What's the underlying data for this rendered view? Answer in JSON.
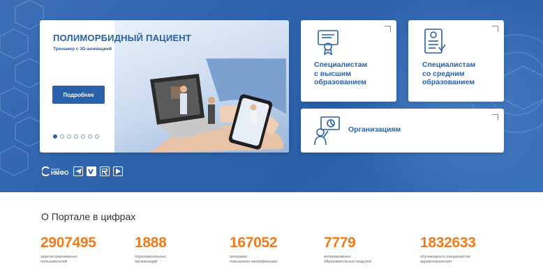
{
  "slider": {
    "title": "ПОЛИМОРБИДНЫЙ ПАЦИЕНТ",
    "subtitle": "Тренажер с 3D-анимацией",
    "more_button": "Подробнее",
    "slide_count": 7,
    "active_slide": 1
  },
  "cards": {
    "higher": {
      "label_line1": "Специалистам",
      "label_line2": "с высшим",
      "label_line3": "образованием",
      "icon": "diploma-icon"
    },
    "secondary": {
      "label_line1": "Специалистам",
      "label_line2": "со средним",
      "label_line3": "образованием",
      "icon": "document-list-icon"
    },
    "orgs": {
      "label": "Организациям",
      "icon": "presenter-icon"
    }
  },
  "social": {
    "logo_small": "портал",
    "logo_text": "НМФО",
    "icons": [
      "telegram-icon",
      "vk-icon",
      "rutube-icon",
      "youtube-icon"
    ]
  },
  "stats": {
    "title": "О Портале в цифрах",
    "items": [
      {
        "value": "2907495",
        "desc": "зарегистрированных\nпользователей"
      },
      {
        "value": "1888",
        "desc": "образовательных\nорганизаций"
      },
      {
        "value": "167052",
        "desc": "программ\nповышения квалификации"
      },
      {
        "value": "7779",
        "desc": "интерактивных\nобразовательных модулей"
      },
      {
        "value": "1832633",
        "desc": "обучающихся специалистов\nздравоохранения"
      }
    ]
  },
  "colors": {
    "brand_blue": "#2a5fa9",
    "accent_orange": "#f07b1c",
    "hero_bg": "#2f63ad"
  }
}
